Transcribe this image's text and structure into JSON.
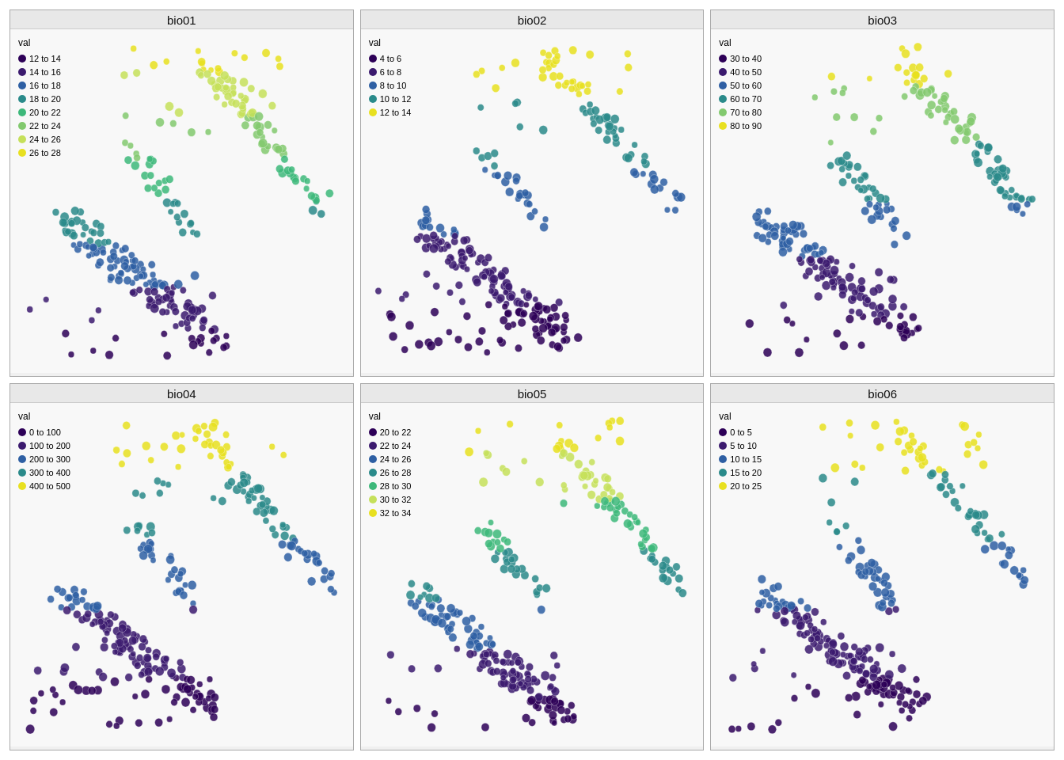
{
  "panels": [
    {
      "id": "bio01",
      "title": "bio01",
      "legend_title": "val",
      "legend": [
        {
          "label": "12 to 14",
          "color": "#2d0057"
        },
        {
          "label": "14 to 16",
          "color": "#3b1a6e"
        },
        {
          "label": "16 to 18",
          "color": "#2e5fa3"
        },
        {
          "label": "18 to 20",
          "color": "#2a8a8a"
        },
        {
          "label": "20 to 22",
          "color": "#3db87a"
        },
        {
          "label": "22 to 24",
          "color": "#82c96e"
        },
        {
          "label": "24 to 26",
          "color": "#c5e05a"
        },
        {
          "label": "26 to 28",
          "color": "#e8e020"
        }
      ],
      "colormap": [
        "#2d0057",
        "#3b1a6e",
        "#2e5fa3",
        "#2a8a8a",
        "#3db87a",
        "#82c96e",
        "#c5e05a",
        "#e8e020"
      ]
    },
    {
      "id": "bio02",
      "title": "bio02",
      "legend_title": "val",
      "legend": [
        {
          "label": "4 to 6",
          "color": "#2d0057"
        },
        {
          "label": "6 to 8",
          "color": "#3b1a6e"
        },
        {
          "label": "8 to 10",
          "color": "#2e5fa3"
        },
        {
          "label": "10 to 12",
          "color": "#2a8a8a"
        },
        {
          "label": "12 to 14",
          "color": "#e8e020"
        }
      ],
      "colormap": [
        "#2d0057",
        "#3b1a6e",
        "#2e5fa3",
        "#2a8a8a",
        "#e8e020"
      ]
    },
    {
      "id": "bio03",
      "title": "bio03",
      "legend_title": "val",
      "legend": [
        {
          "label": "30 to 40",
          "color": "#2d0057"
        },
        {
          "label": "40 to 50",
          "color": "#3b1a6e"
        },
        {
          "label": "50 to 60",
          "color": "#2e5fa3"
        },
        {
          "label": "60 to 70",
          "color": "#2a8a8a"
        },
        {
          "label": "70 to 80",
          "color": "#82c96e"
        },
        {
          "label": "80 to 90",
          "color": "#e8e020"
        }
      ],
      "colormap": [
        "#2d0057",
        "#3b1a6e",
        "#2e5fa3",
        "#2a8a8a",
        "#82c96e",
        "#e8e020"
      ]
    },
    {
      "id": "bio04",
      "title": "bio04",
      "legend_title": "val",
      "legend": [
        {
          "label": "0 to 100",
          "color": "#2d0057"
        },
        {
          "label": "100 to 200",
          "color": "#3b1a6e"
        },
        {
          "label": "200 to 300",
          "color": "#2e5fa3"
        },
        {
          "label": "300 to 400",
          "color": "#2a8a8a"
        },
        {
          "label": "400 to 500",
          "color": "#e8e020"
        }
      ],
      "colormap": [
        "#2d0057",
        "#3b1a6e",
        "#2e5fa3",
        "#2a8a8a",
        "#e8e020"
      ]
    },
    {
      "id": "bio05",
      "title": "bio05",
      "legend_title": "val",
      "legend": [
        {
          "label": "20 to 22",
          "color": "#2d0057"
        },
        {
          "label": "22 to 24",
          "color": "#3b1a6e"
        },
        {
          "label": "24 to 26",
          "color": "#2e5fa3"
        },
        {
          "label": "26 to 28",
          "color": "#2a8a8a"
        },
        {
          "label": "28 to 30",
          "color": "#3db87a"
        },
        {
          "label": "30 to 32",
          "color": "#c5e05a"
        },
        {
          "label": "32 to 34",
          "color": "#e8e020"
        }
      ],
      "colormap": [
        "#2d0057",
        "#3b1a6e",
        "#2e5fa3",
        "#2a8a8a",
        "#3db87a",
        "#c5e05a",
        "#e8e020"
      ]
    },
    {
      "id": "bio06",
      "title": "bio06",
      "legend_title": "val",
      "legend": [
        {
          "label": "0 to 5",
          "color": "#2d0057"
        },
        {
          "label": "5 to 10",
          "color": "#3b1a6e"
        },
        {
          "label": "10 to 15",
          "color": "#2e5fa3"
        },
        {
          "label": "15 to 20",
          "color": "#2a8a8a"
        },
        {
          "label": "20 to 25",
          "color": "#e8e020"
        }
      ],
      "colormap": [
        "#2d0057",
        "#3b1a6e",
        "#2e5fa3",
        "#2a8a8a",
        "#e8e020"
      ]
    }
  ]
}
